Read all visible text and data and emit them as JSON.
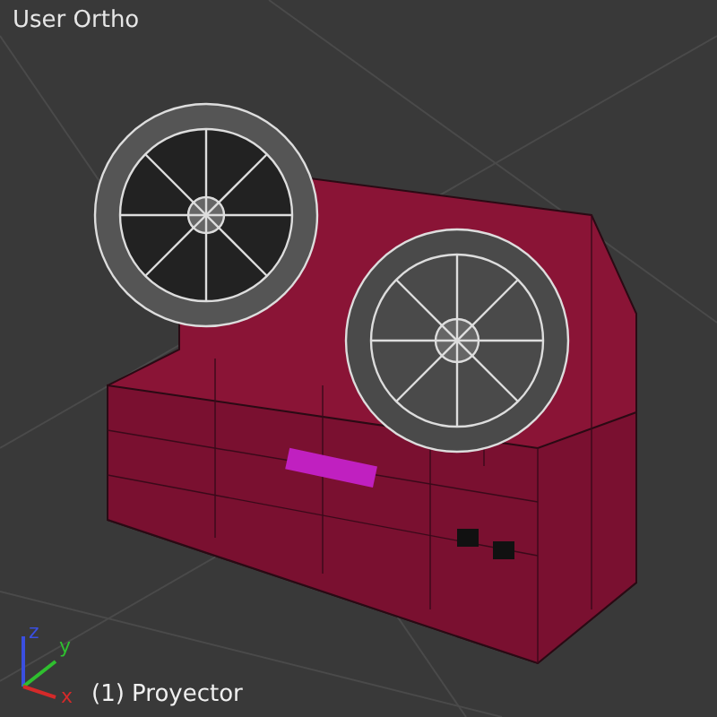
{
  "viewport": {
    "view_label": "User Ortho",
    "object_label": "(1) Proyector"
  },
  "axes": [
    {
      "label": "z",
      "color": "#3a4fe0"
    },
    {
      "label": "y",
      "color": "#2fbf2f"
    },
    {
      "label": "x",
      "color": "#d42a2a"
    }
  ]
}
